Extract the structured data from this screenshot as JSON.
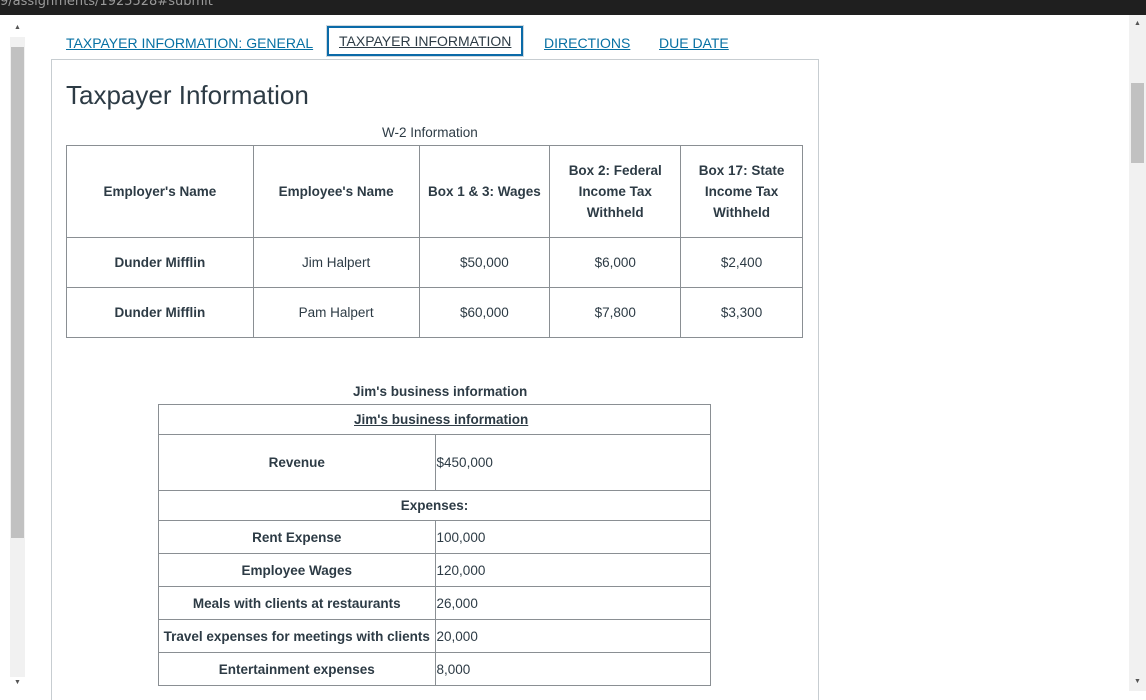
{
  "browser": {
    "url_fragment": "9/assignments/1925528#submit"
  },
  "tabs": [
    {
      "label": "TAXPAYER INFORMATION: GENERAL"
    },
    {
      "label": "TAXPAYER INFORMATION"
    },
    {
      "label": "DIRECTIONS"
    },
    {
      "label": "DUE DATE"
    }
  ],
  "page": {
    "title": "Taxpayer Information"
  },
  "w2": {
    "caption": "W-2 Information",
    "headers": {
      "employer": "Employer's Name",
      "employee": "Employee's Name",
      "wages": "Box 1 & 3: Wages",
      "fed_1": "Box 2: Federal",
      "fed_2": "Income Tax",
      "fed_3": "Withheld",
      "state_1": "Box 17: State",
      "state_2": "Income Tax",
      "state_3": "Withheld"
    },
    "rows": [
      {
        "employer": "Dunder Mifflin",
        "employee": "Jim Halpert",
        "wages": "$50,000",
        "federal": "$6,000",
        "state": "$2,400"
      },
      {
        "employer": "Dunder Mifflin",
        "employee": "Pam Halpert",
        "wages": "$60,000",
        "federal": "$7,800",
        "state": "$3,300"
      }
    ]
  },
  "business": {
    "caption": "Jim's business information",
    "header": "Jim's business information",
    "revenue_label": "Revenue",
    "revenue_value": "$450,000",
    "expenses_label": "Expenses:",
    "expenses": [
      {
        "label": "Rent Expense",
        "value": "100,000"
      },
      {
        "label": "Employee Wages",
        "value": "120,000"
      },
      {
        "label": "Meals with clients at restaurants",
        "value": "26,000"
      },
      {
        "label": "Travel expenses for meetings with clients",
        "value": "20,000"
      },
      {
        "label": "Entertainment expenses",
        "value": "8,000"
      }
    ]
  }
}
